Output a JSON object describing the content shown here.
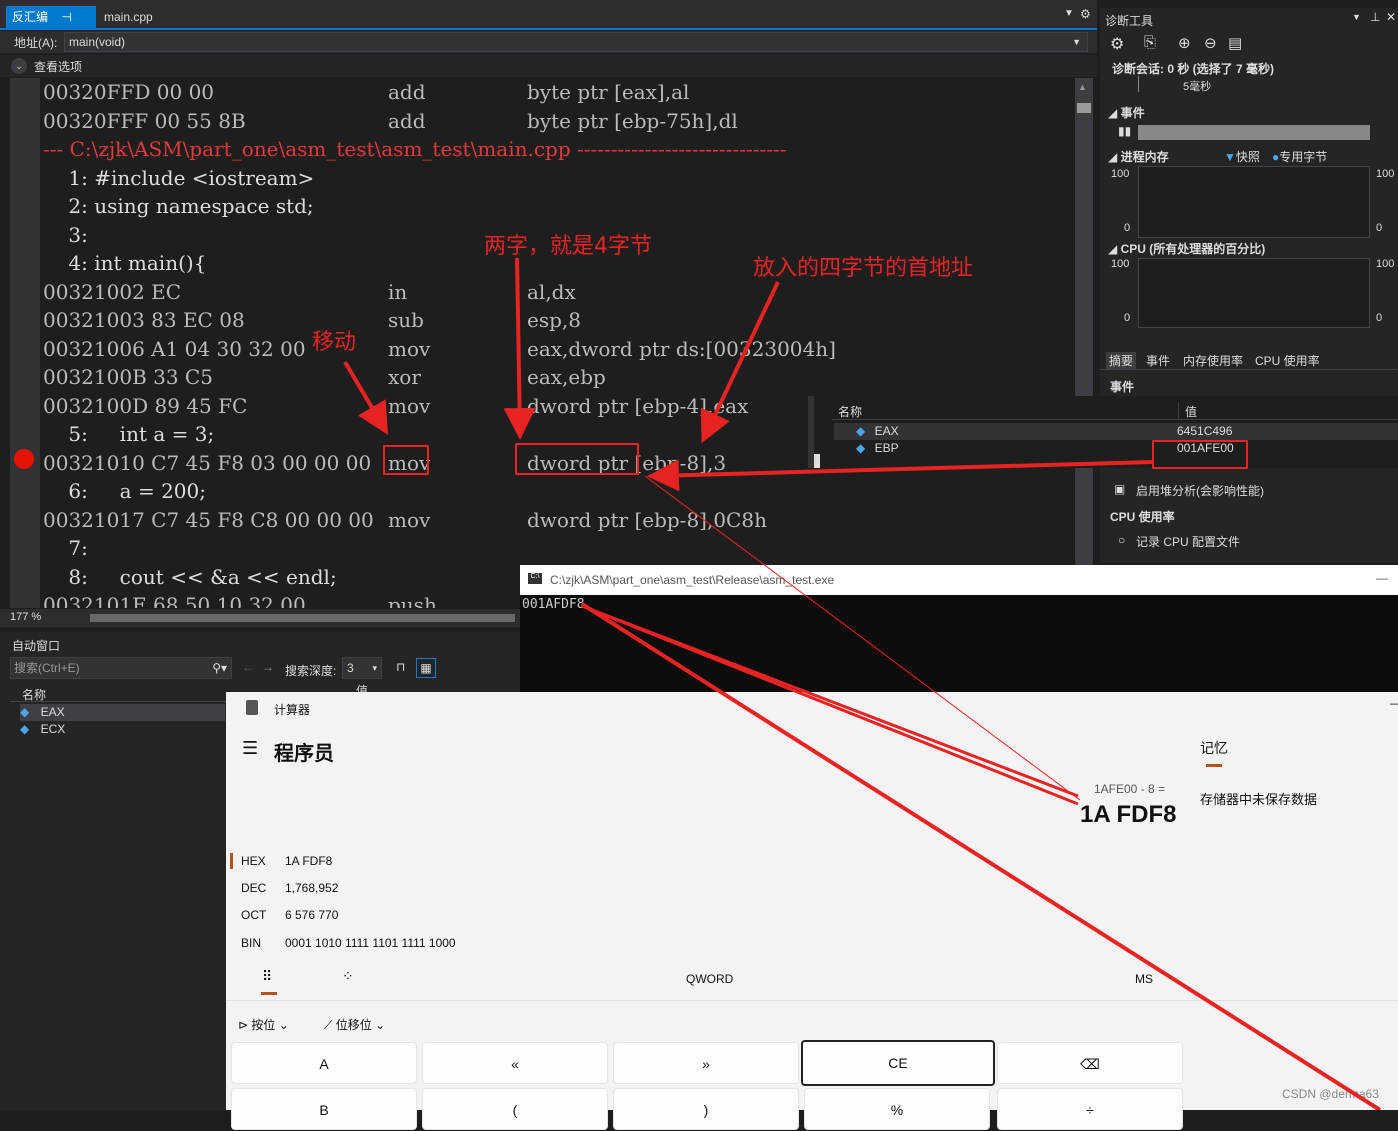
{
  "tabs": {
    "disasm": "反汇编",
    "pin": "⊣",
    "close": "✕",
    "main": "main.cpp"
  },
  "address": {
    "label": "地址(A):",
    "value": "main(void)"
  },
  "options": {
    "label": "查看选项"
  },
  "code_lines": [
    {
      "a": "00320FFD 00 00",
      "m": "add",
      "o": "byte ptr [eax],al",
      "t": "asm"
    },
    {
      "a": "00320FFF 00 55 8B",
      "m": "add",
      "o": "byte ptr [ebp-75h],dl",
      "t": "asm"
    },
    {
      "a": "--- C:\\zjk\\ASM\\part_one\\asm_test\\asm_test\\main.cpp -------------------------------",
      "m": "",
      "o": "",
      "t": "file"
    },
    {
      "a": "    1: #include <iostream>",
      "m": "",
      "o": "",
      "t": "src"
    },
    {
      "a": "    2: using namespace std;",
      "m": "",
      "o": "",
      "t": "src"
    },
    {
      "a": "    3:",
      "m": "",
      "o": "",
      "t": "src"
    },
    {
      "a": "    4: int main(){",
      "m": "",
      "o": "",
      "t": "src"
    },
    {
      "a": "00321002 EC",
      "m": "in",
      "o": "al,dx",
      "t": "asm"
    },
    {
      "a": "00321003 83 EC 08",
      "m": "sub",
      "o": "esp,8",
      "t": "asm"
    },
    {
      "a": "00321006 A1 04 30 32 00",
      "m": "mov",
      "o": "eax,dword ptr ds:[00323004h]",
      "t": "asm"
    },
    {
      "a": "0032100B 33 C5",
      "m": "xor",
      "o": "eax,ebp",
      "t": "asm"
    },
    {
      "a": "0032100D 89 45 FC",
      "m": "mov",
      "o": "dword ptr [ebp-4],eax",
      "t": "asm"
    },
    {
      "a": "    5:     int a = 3;",
      "m": "",
      "o": "",
      "t": "src"
    },
    {
      "a": "00321010 C7 45 F8 03 00 00 00",
      "m": "mov",
      "o": "dword ptr [ebp-8],3",
      "t": "asm"
    },
    {
      "a": "    6:     a = 200;",
      "m": "",
      "o": "",
      "t": "src"
    },
    {
      "a": "00321017 C7 45 F8 C8 00 00 00",
      "m": "mov",
      "o": "dword ptr [ebp-8],0C8h",
      "t": "asm"
    },
    {
      "a": "    7:",
      "m": "",
      "o": "",
      "t": "src"
    },
    {
      "a": "    8:     cout << &a << endl;",
      "m": "",
      "o": "",
      "t": "src"
    },
    {
      "a": "0032101E 68 50 10 32 00",
      "m": "push",
      "o": "",
      "t": "asm"
    }
  ],
  "zoom": "177 %",
  "auto": {
    "title": "自动窗口",
    "search_placeholder": "搜索(Ctrl+E)",
    "depth_label": "搜索深度:",
    "depth_value": "3",
    "col_name": "名称",
    "col_value": "值",
    "rows": [
      "EAX",
      "ECX"
    ]
  },
  "diag": {
    "title": "诊断工具",
    "session": "诊断会话: 0 秒 (选择了 7 毫秒)",
    "tick": "5毫秒",
    "events": "事件",
    "mem": "进程内存",
    "snapshot": "快照",
    "private": "专用字节",
    "cpu": "CPU (所有处理器的百分比)",
    "y100": "100",
    "y0": "0",
    "tabs": [
      "摘要",
      "事件",
      "内存使用率",
      "CPU 使用率"
    ],
    "events2": "事件",
    "heap": "启用堆分析(会影响性能)",
    "cpu_use": "CPU 使用率",
    "record": "记录 CPU 配置文件"
  },
  "regs": {
    "col_name": "名称",
    "col_value": "值",
    "rows": [
      {
        "n": "EAX",
        "v": "6451C496"
      },
      {
        "n": "EBP",
        "v": "001AFE00"
      }
    ]
  },
  "console": {
    "title": "C:\\zjk\\ASM\\part_one\\asm_test\\Release\\asm_test.exe",
    "output": "001AFDF8",
    "min": "—"
  },
  "calc": {
    "app": "计算器",
    "mode": "程序员",
    "memory": "记忆",
    "memory_empty": "存储器中未保存数据",
    "expr": "1AFE00 - 8 =",
    "result": "1A FDF8",
    "rows": [
      {
        "k": "HEX",
        "v": "1A FDF8"
      },
      {
        "k": "DEC",
        "v": "1,768,952"
      },
      {
        "k": "OCT",
        "v": "6 576 770"
      },
      {
        "k": "BIN",
        "v": "0001 1010 1111 1101 1111 1000"
      }
    ],
    "word": "QWORD",
    "ms": "MS",
    "bitwise": "按位",
    "bitshift": "位移位",
    "keys": [
      "A",
      "«",
      "»",
      "CE",
      "⌫"
    ],
    "keys2": [
      "B",
      "(",
      ")",
      "%",
      "÷"
    ]
  },
  "annotations": {
    "move": "移动",
    "two_words": "两字，就是4字节",
    "first_addr": "放入的四字节的首地址"
  },
  "watermark": "CSDN @derma63"
}
